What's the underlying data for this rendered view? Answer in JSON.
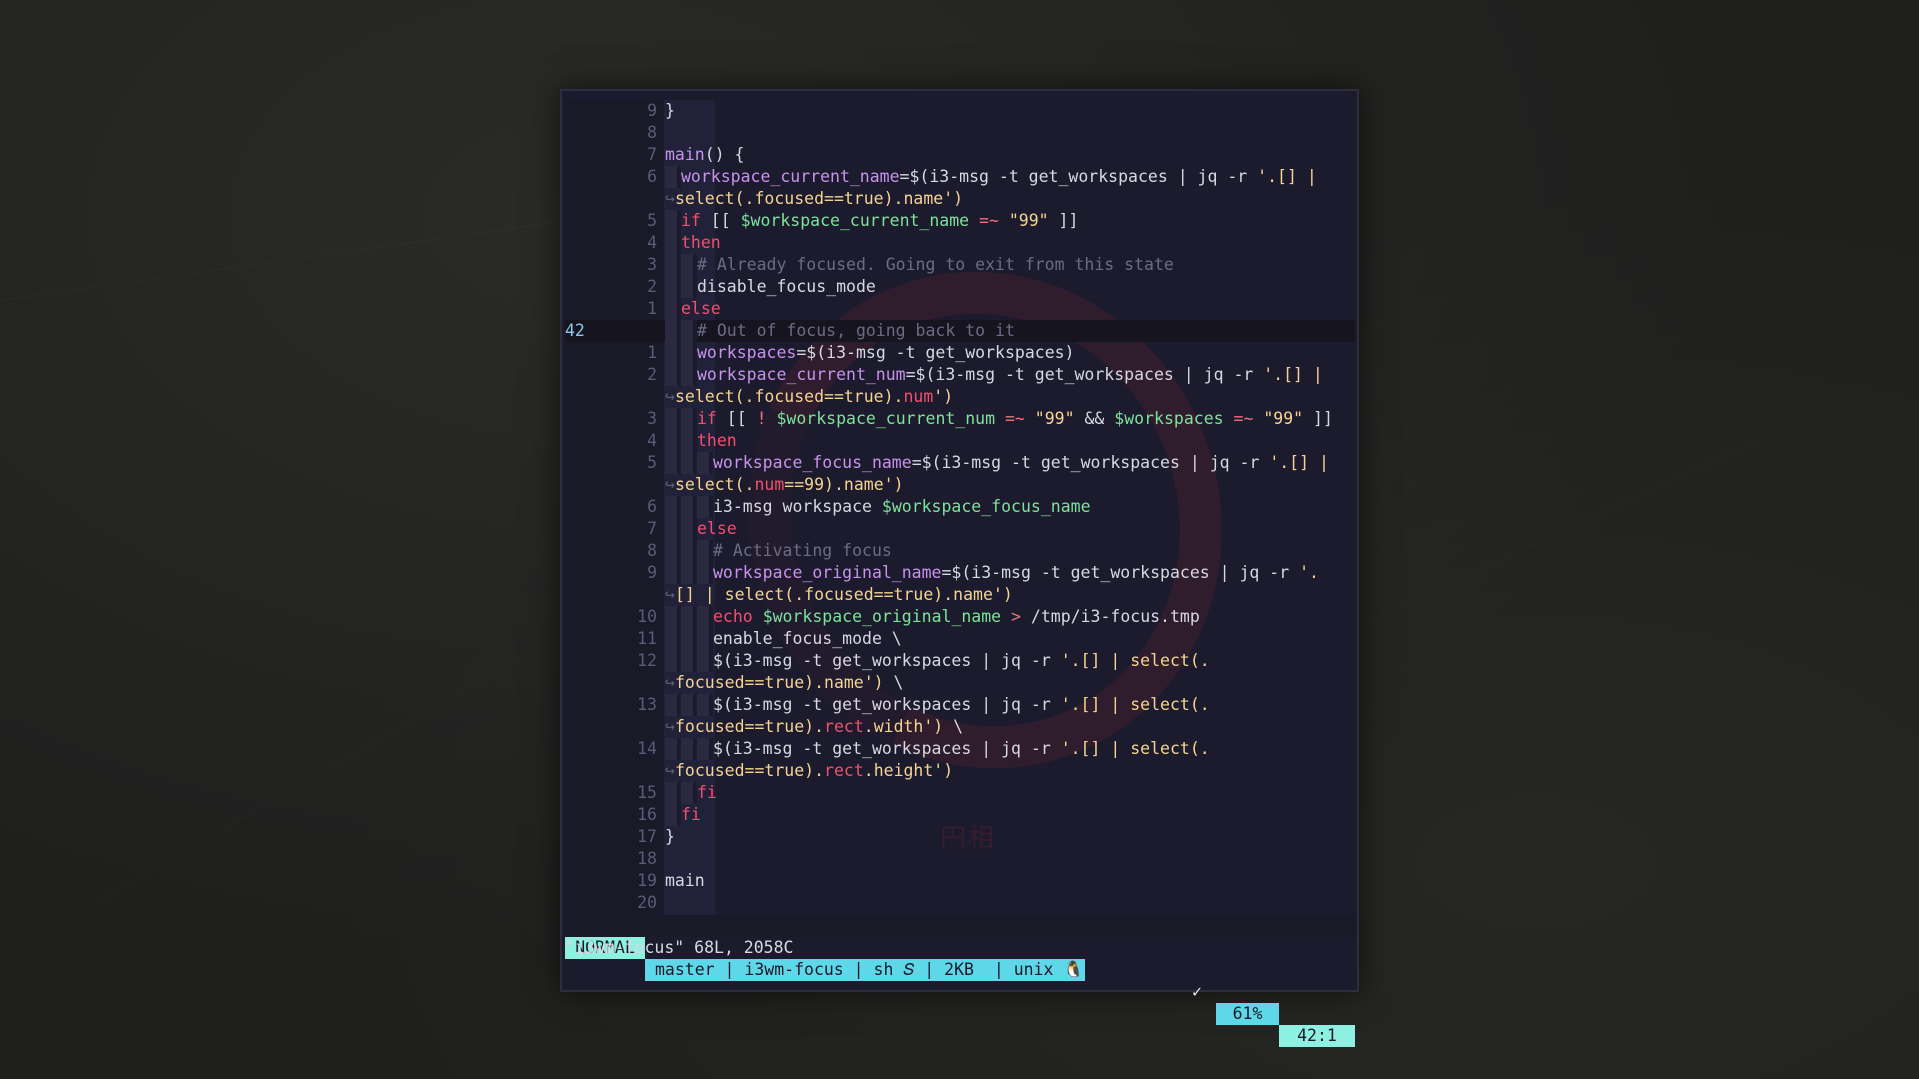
{
  "editor": {
    "lines": [
      {
        "ln": "9",
        "segs": [
          {
            "c": "t-txt",
            "t": "}"
          }
        ]
      },
      {
        "ln": "8",
        "segs": []
      },
      {
        "ln": "7",
        "segs": [
          {
            "c": "t-var",
            "t": "main"
          },
          {
            "c": "t-txt",
            "t": "() {"
          }
        ]
      },
      {
        "ln": "6",
        "indent": 1,
        "segs": [
          {
            "c": "t-var",
            "t": "workspace_current_name"
          },
          {
            "c": "t-txt",
            "t": "=$(i3-msg -t get_workspaces | jq -r "
          },
          {
            "c": "t-str",
            "t": "'.[] |"
          }
        ]
      },
      {
        "ln": "",
        "wrap": true,
        "segs": [
          {
            "c": "t-str",
            "t": "select(.focused==true).name')"
          }
        ]
      },
      {
        "ln": "5",
        "indent": 1,
        "segs": [
          {
            "c": "t-kw",
            "t": "if"
          },
          {
            "c": "t-txt",
            "t": " [[ "
          },
          {
            "c": "t-green",
            "t": "$workspace_current_name"
          },
          {
            "c": "t-op",
            "t": " =~ "
          },
          {
            "c": "t-str",
            "t": "\"99\""
          },
          {
            "c": "t-txt",
            "t": " ]]"
          }
        ]
      },
      {
        "ln": "4",
        "indent": 1,
        "segs": [
          {
            "c": "t-kw",
            "t": "then"
          }
        ]
      },
      {
        "ln": "3",
        "indent": 2,
        "segs": [
          {
            "c": "t-cmt",
            "t": "# Already focused. Going to exit from this state"
          }
        ]
      },
      {
        "ln": "2",
        "indent": 2,
        "segs": [
          {
            "c": "t-txt",
            "t": "disable_focus_mode"
          }
        ]
      },
      {
        "ln": "1",
        "indent": 1,
        "segs": [
          {
            "c": "t-kw",
            "t": "else"
          }
        ]
      },
      {
        "ln": "42",
        "current": true,
        "cursor": true,
        "indent": 2,
        "segs": [
          {
            "c": "t-cmt",
            "t": "# Out of focus, going back to it"
          }
        ]
      },
      {
        "ln": "1",
        "indent": 2,
        "segs": [
          {
            "c": "t-var",
            "t": "workspaces"
          },
          {
            "c": "t-txt",
            "t": "=$(i3-msg -t get_workspaces)"
          }
        ]
      },
      {
        "ln": "2",
        "indent": 2,
        "segs": [
          {
            "c": "t-var",
            "t": "workspace_current_num"
          },
          {
            "c": "t-txt",
            "t": "=$(i3-msg -t get_workspaces | jq -r "
          },
          {
            "c": "t-str",
            "t": "'.[] |"
          }
        ]
      },
      {
        "ln": "",
        "wrap": true,
        "segs": [
          {
            "c": "t-str",
            "t": "select(.focused==true)."
          },
          {
            "c": "t-red",
            "t": "num"
          },
          {
            "c": "t-str",
            "t": "')"
          }
        ]
      },
      {
        "ln": "3",
        "indent": 2,
        "segs": [
          {
            "c": "t-kw",
            "t": "if"
          },
          {
            "c": "t-txt",
            "t": " [[ "
          },
          {
            "c": "t-op",
            "t": "!"
          },
          {
            "c": "t-txt",
            "t": " "
          },
          {
            "c": "t-green",
            "t": "$workspace_current_num"
          },
          {
            "c": "t-op",
            "t": " =~ "
          },
          {
            "c": "t-str",
            "t": "\"99\""
          },
          {
            "c": "t-txt",
            "t": " && "
          },
          {
            "c": "t-green",
            "t": "$workspaces"
          },
          {
            "c": "t-op",
            "t": " =~ "
          },
          {
            "c": "t-str",
            "t": "\"99\""
          },
          {
            "c": "t-txt",
            "t": " ]]"
          }
        ]
      },
      {
        "ln": "4",
        "indent": 2,
        "segs": [
          {
            "c": "t-kw",
            "t": "then"
          }
        ]
      },
      {
        "ln": "5",
        "indent": 3,
        "segs": [
          {
            "c": "t-var",
            "t": "workspace_focus_name"
          },
          {
            "c": "t-txt",
            "t": "=$(i3-msg -t get_workspaces | jq -r "
          },
          {
            "c": "t-str",
            "t": "'.[] |"
          }
        ]
      },
      {
        "ln": "",
        "wrap": true,
        "segs": [
          {
            "c": "t-str",
            "t": "select(."
          },
          {
            "c": "t-red",
            "t": "num"
          },
          {
            "c": "t-str",
            "t": "==99).name')"
          }
        ]
      },
      {
        "ln": "6",
        "indent": 3,
        "segs": [
          {
            "c": "t-txt",
            "t": "i3-msg workspace "
          },
          {
            "c": "t-green",
            "t": "$workspace_focus_name"
          }
        ]
      },
      {
        "ln": "7",
        "indent": 2,
        "segs": [
          {
            "c": "t-kw",
            "t": "else"
          }
        ]
      },
      {
        "ln": "8",
        "indent": 3,
        "segs": [
          {
            "c": "t-cmt",
            "t": "# Activating focus"
          }
        ]
      },
      {
        "ln": "9",
        "indent": 3,
        "segs": [
          {
            "c": "t-var",
            "t": "workspace_original_name"
          },
          {
            "c": "t-txt",
            "t": "=$(i3-msg -t get_workspaces | jq -r "
          },
          {
            "c": "t-str",
            "t": "'."
          }
        ]
      },
      {
        "ln": "",
        "wrap": true,
        "segs": [
          {
            "c": "t-str",
            "t": "[] | select(.focused==true).name')"
          }
        ]
      },
      {
        "ln": "10",
        "indent": 3,
        "segs": [
          {
            "c": "t-kw",
            "t": "echo"
          },
          {
            "c": "t-txt",
            "t": " "
          },
          {
            "c": "t-green",
            "t": "$workspace_original_name"
          },
          {
            "c": "t-op",
            "t": " > "
          },
          {
            "c": "t-txt",
            "t": "/tmp/i3-focus.tmp"
          }
        ]
      },
      {
        "ln": "11",
        "indent": 3,
        "segs": [
          {
            "c": "t-txt",
            "t": "enable_focus_mode \\"
          }
        ]
      },
      {
        "ln": "12",
        "indent": 3,
        "segs": [
          {
            "c": "t-txt",
            "t": "$(i3-msg -t get_workspaces | jq -r "
          },
          {
            "c": "t-str",
            "t": "'.[] | select(."
          }
        ]
      },
      {
        "ln": "",
        "wrap": true,
        "segs": [
          {
            "c": "t-str",
            "t": "focused==true).name')"
          },
          {
            "c": "t-txt",
            "t": " \\"
          }
        ]
      },
      {
        "ln": "13",
        "indent": 3,
        "segs": [
          {
            "c": "t-txt",
            "t": "$(i3-msg -t get_workspaces | jq -r "
          },
          {
            "c": "t-str",
            "t": "'.[] | select(."
          }
        ]
      },
      {
        "ln": "",
        "wrap": true,
        "segs": [
          {
            "c": "t-str",
            "t": "focused==true)."
          },
          {
            "c": "t-red",
            "t": "rect"
          },
          {
            "c": "t-str",
            "t": ".width')"
          },
          {
            "c": "t-txt",
            "t": " \\"
          }
        ]
      },
      {
        "ln": "14",
        "indent": 3,
        "segs": [
          {
            "c": "t-txt",
            "t": "$(i3-msg -t get_workspaces | jq -r "
          },
          {
            "c": "t-str",
            "t": "'.[] | select(."
          }
        ]
      },
      {
        "ln": "",
        "wrap": true,
        "segs": [
          {
            "c": "t-str",
            "t": "focused==true)."
          },
          {
            "c": "t-red",
            "t": "rect"
          },
          {
            "c": "t-str",
            "t": ".height')"
          }
        ]
      },
      {
        "ln": "15",
        "indent": 2,
        "segs": [
          {
            "c": "t-kw",
            "t": "fi"
          }
        ]
      },
      {
        "ln": "16",
        "indent": 1,
        "segs": [
          {
            "c": "t-kw",
            "t": "fi"
          }
        ]
      },
      {
        "ln": "17",
        "segs": [
          {
            "c": "t-txt",
            "t": "}"
          }
        ]
      },
      {
        "ln": "18",
        "segs": []
      },
      {
        "ln": "19",
        "segs": [
          {
            "c": "t-txt",
            "t": "main"
          }
        ]
      },
      {
        "ln": "20",
        "segs": []
      }
    ]
  },
  "statusline": {
    "mode": "NORMAL",
    "info": "master | i3wm-focus | sh 𝑆 | 2KB  | unix 🐧",
    "check": "✓",
    "percent": "61%",
    "position": "42:1"
  },
  "cmdline": "\"i3wm-focus\" 68L, 2058C",
  "wallpaper": {
    "watermark": "円相"
  }
}
